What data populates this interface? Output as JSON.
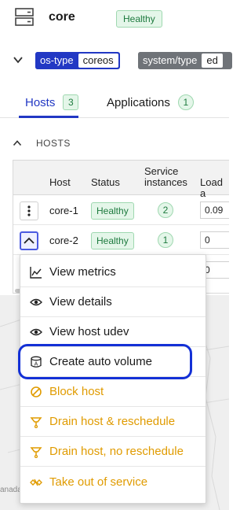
{
  "header": {
    "title": "core",
    "status": "Healthy"
  },
  "filters": [
    {
      "key": "os-type",
      "value": "coreos"
    },
    {
      "key": "system/type",
      "value": "ed"
    }
  ],
  "tabs": [
    {
      "label": "Hosts",
      "count": "3"
    },
    {
      "label": "Applications",
      "count": "1"
    }
  ],
  "section": {
    "title": "HOSTS"
  },
  "table": {
    "columns": [
      "Host",
      "Status",
      "Service",
      "instances",
      "Load a"
    ],
    "rows": [
      {
        "host": "core-1",
        "status": "Healthy",
        "services": "2",
        "load": "0.09"
      },
      {
        "host": "core-2",
        "status": "Healthy",
        "services": "1",
        "load": "0"
      },
      {
        "load": "0"
      }
    ]
  },
  "menu": {
    "items": [
      {
        "label": "View metrics",
        "icon": "chart-line-icon"
      },
      {
        "label": "View details",
        "icon": "eye-icon"
      },
      {
        "label": "View host udev",
        "icon": "eye-icon"
      },
      {
        "label": "Create auto volume",
        "icon": "volume-icon"
      },
      {
        "label": "Block host",
        "icon": "block-icon"
      },
      {
        "label": "Drain host & reschedule",
        "icon": "drain-icon"
      },
      {
        "label": "Drain host, no reschedule",
        "icon": "drain-icon"
      },
      {
        "label": "Take out of service",
        "icon": "out-of-service-icon"
      }
    ]
  },
  "map": {
    "label": "anada"
  },
  "colors": {
    "accent": "#2238c4",
    "warning": "#e09b00",
    "healthy": "#1d7a3e",
    "highlight": "#1330d6"
  }
}
